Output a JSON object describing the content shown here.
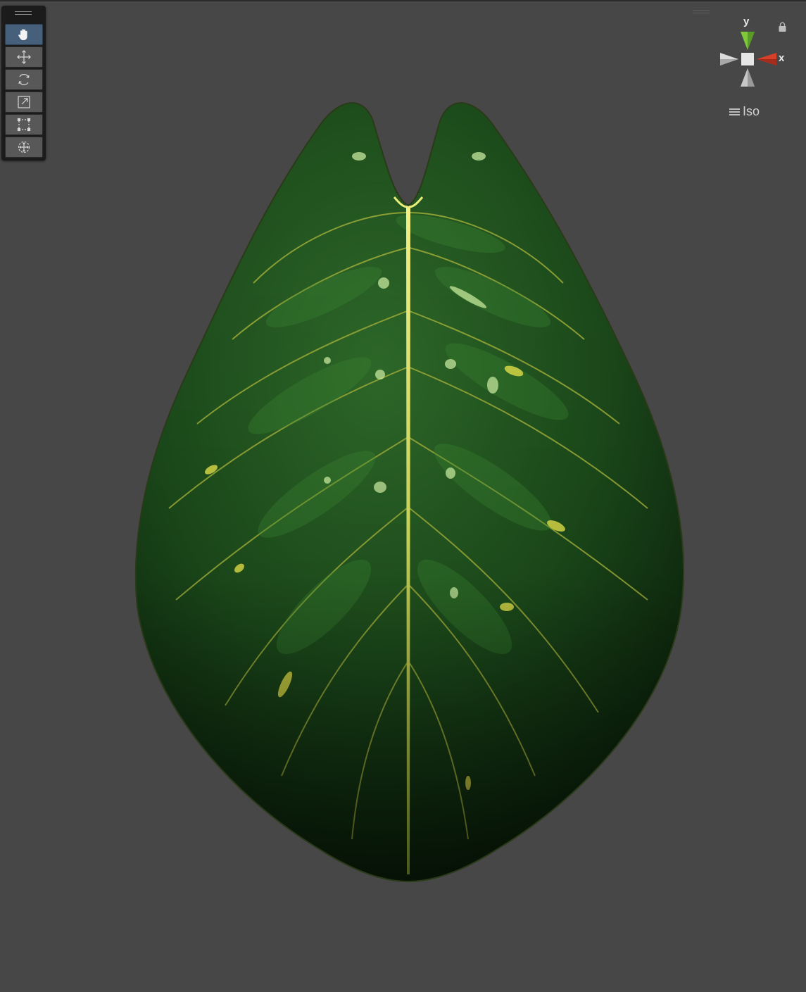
{
  "scene_view": {
    "background_color": "#474747",
    "tools": [
      {
        "name": "hand-tool",
        "icon": "hand-icon",
        "active": true
      },
      {
        "name": "move-tool",
        "icon": "move-icon",
        "active": false
      },
      {
        "name": "rotate-tool",
        "icon": "rotate-icon",
        "active": false
      },
      {
        "name": "scale-tool",
        "icon": "scale-icon",
        "active": false
      },
      {
        "name": "rect-tool",
        "icon": "rect-icon",
        "active": false
      },
      {
        "name": "transform-tool",
        "icon": "transform-icon",
        "active": false
      }
    ],
    "gizmo": {
      "y_label": "y",
      "x_label": "x",
      "projection_label": "Iso",
      "y_color": "#7ec83a",
      "x_color": "#d6402b",
      "lock_icon": "lock-icon"
    },
    "object": {
      "name": "leaf-mesh",
      "base_color": "#1d4a1d",
      "vein_color": "#d9e36a"
    }
  }
}
